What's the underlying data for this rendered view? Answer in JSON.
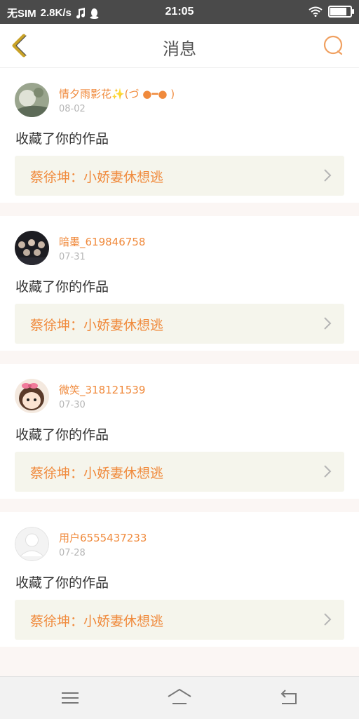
{
  "status_bar": {
    "carrier": "无SIM",
    "speed": "2.8K/s",
    "time": "21:05",
    "battery_level": 0.9
  },
  "header": {
    "title": "消息"
  },
  "messages": [
    {
      "username": "情夕雨影花✨(づ ●━● )",
      "date": "08-02",
      "action": "收藏了你的作品",
      "work": "蔡徐坤：小娇妻休想逃"
    },
    {
      "username": "暗墨_619846758",
      "date": "07-31",
      "action": "收藏了你的作品",
      "work": "蔡徐坤：小娇妻休想逃"
    },
    {
      "username": "微笑_318121539",
      "date": "07-30",
      "action": "收藏了你的作品",
      "work": "蔡徐坤：小娇妻休想逃"
    },
    {
      "username": "用户6555437233",
      "date": "07-28",
      "action": "收藏了你的作品",
      "work": "蔡徐坤：小娇妻休想逃"
    }
  ],
  "colors": {
    "accent": "#f08a3c",
    "status_bar": "#4a4a4a",
    "link_bg": "#f5f5ec",
    "background": "#fbf6f4"
  },
  "icons": {
    "back": "chevron-left-icon",
    "search": "search-icon",
    "menu": "menu-icon",
    "home": "home-icon",
    "return": "back-arrow-icon"
  }
}
